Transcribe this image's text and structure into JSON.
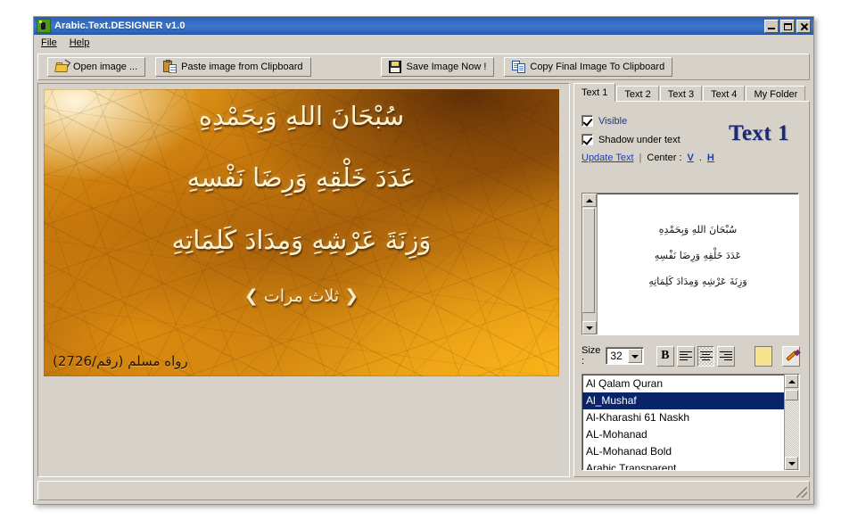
{
  "window": {
    "title": "Arabic.Text.DESIGNER  v1.0",
    "app_icon": "green-app-icon",
    "minimize_label": "_",
    "maximize_label": "□",
    "close_label": "×"
  },
  "menu": {
    "items": [
      {
        "label": "File",
        "mnemonic": "F"
      },
      {
        "label": "Help",
        "mnemonic": "H"
      }
    ]
  },
  "toolbar": {
    "open_image": "Open image ...",
    "paste_clipboard": "Paste image from Clipboard",
    "save_image": "Save Image Now !",
    "copy_clipboard": "Copy Final Image To Clipboard"
  },
  "canvas": {
    "lines": [
      "سُبْحَانَ اللهِ وَبِحَمْدِهِ",
      "عَدَدَ خَلْقِهِ وَرِضَا نَفْسِهِ",
      "وَزِنَةَ عَرْشِهِ وَمِدَادَ كَلِمَاتِهِ"
    ],
    "repeat_note": "❮ ثلاث مرات ❯",
    "credit": "رواه مسلم (رقم/2726)",
    "text_color": "#fdf3cf",
    "credit_color": "#211206"
  },
  "right_panel": {
    "tabs": [
      {
        "label": "Text 1",
        "active": true
      },
      {
        "label": "Text 2",
        "active": false
      },
      {
        "label": "Text 3",
        "active": false
      },
      {
        "label": "Text 4",
        "active": false
      },
      {
        "label": "My Folder",
        "active": false
      }
    ],
    "visible_checkbox": {
      "label": "Visible",
      "checked": true,
      "color": "#24348c"
    },
    "shadow_checkbox": {
      "label": "Shadow under text",
      "checked": true,
      "color": "#000000"
    },
    "update_text_link": "Update Text",
    "separator": "|",
    "center_label": "Center :",
    "center_v": "V",
    "center_dot": ".",
    "center_h": "H",
    "big_label": "Text 1",
    "big_label_color": "#1b2a6e",
    "preview_lines": [
      "سُبْحَانَ اللهِ وَبِحَمْدِهِ",
      "عَدَدَ خَلْقِهِ وَرِضَا نَفْسِهِ",
      "وَزِنَةَ عَرْشِهِ وَمِدَادَ كَلِمَاتِهِ"
    ]
  },
  "format": {
    "size_label": "Size :",
    "size_value": "32",
    "bold_label": "B",
    "align_left": "align-left",
    "align_center": "align-center",
    "align_right": "align-right",
    "active_align": "align-center",
    "color_swatch": "#f7e38e",
    "picker_icon": "eyedropper-icon"
  },
  "font_list": {
    "items": [
      {
        "name": "Al Qalam Quran",
        "selected": false
      },
      {
        "name": "Al_Mushaf",
        "selected": true
      },
      {
        "name": "Al-Kharashi 61 Naskh",
        "selected": false
      },
      {
        "name": "AL-Mohanad",
        "selected": false
      },
      {
        "name": "AL-Mohanad Bold",
        "selected": false
      },
      {
        "name": "Arabic Transparent",
        "selected": false
      }
    ],
    "selected_bg": "#0a246a"
  },
  "status_bar": {
    "text": ""
  }
}
